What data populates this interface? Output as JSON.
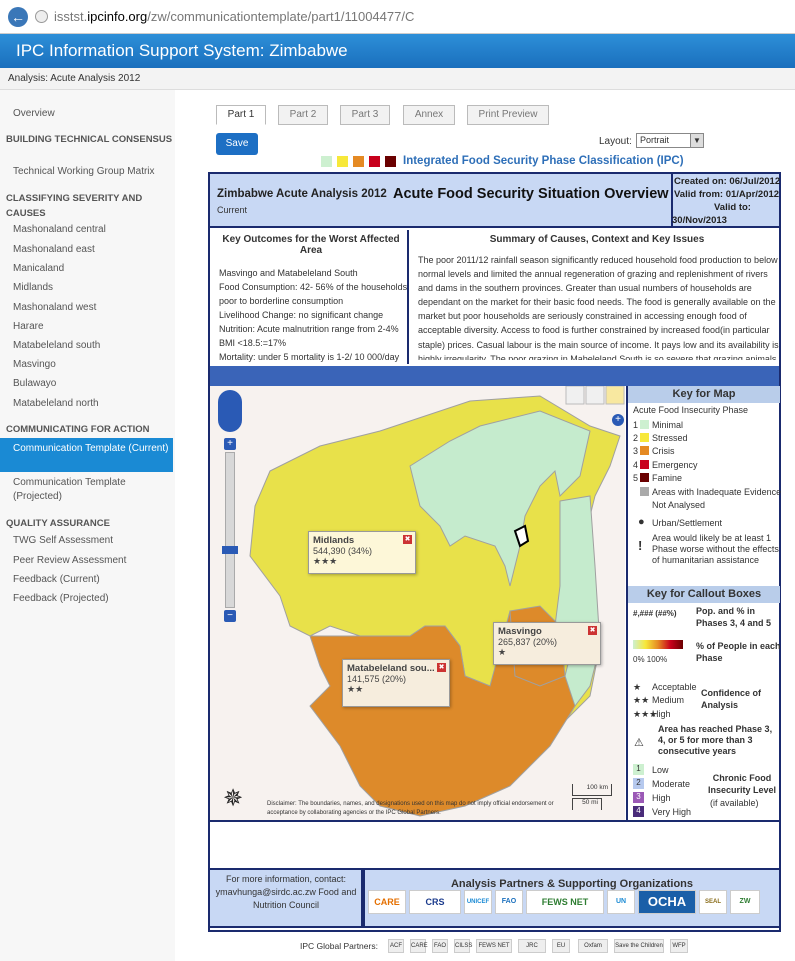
{
  "browser": {
    "url_prefix": "isstst.",
    "url_domain": "ipcinfo.org",
    "url_path": "/zw/communicationtemplate/part1/11004477/C"
  },
  "banner": {
    "title": "IPC Information Support System: Zimbabwe"
  },
  "analysis_bar": {
    "label": "Analysis: Acute Analysis 2012"
  },
  "sidebar": {
    "overview": "Overview",
    "section1": "BUILDING TECHNICAL CONSENSUS",
    "twg_matrix": "Technical Working Group Matrix",
    "section2": "CLASSIFYING SEVERITY AND CAUSES",
    "regions": [
      "Mashonaland central",
      "Mashonaland east",
      "Manicaland",
      "Midlands",
      "Mashonaland west",
      "Harare",
      "Matabeleland south",
      "Masvingo",
      "Bulawayo",
      "Matabeleland north"
    ],
    "section3": "COMMUNICATING FOR ACTION",
    "comm_current": "Communication Template (Current)",
    "comm_projected": "Communication Template (Projected)",
    "section4": "QUALITY ASSURANCE",
    "qa": [
      "TWG Self Assessment",
      "Peer Review Assessment",
      "Feedback (Current)",
      "Feedback (Projected)"
    ]
  },
  "tabs": [
    "Part 1",
    "Part 2",
    "Part 3",
    "Annex",
    "Print Preview"
  ],
  "toolbar": {
    "save": "Save",
    "layout_label": "Layout:",
    "layout_value": "Portrait"
  },
  "ipc_link": "Integrated Food Security Phase Classification (IPC)",
  "phase_colors": [
    "#cdf0d0",
    "#f7e83a",
    "#e58a23",
    "#c8001c",
    "#6a0000"
  ],
  "header": {
    "title": "Zimbabwe Acute Analysis 2012",
    "subtitle": "Current",
    "main_title": "Acute Food Security Situation Overview",
    "created": "Created on: 06/Jul/2012",
    "valid_from": "Valid from: 01/Apr/2012",
    "valid_to": "Valid to:",
    "valid_to_date": "30/Nov/2013"
  },
  "key_outcomes": {
    "heading": "Key Outcomes for the Worst Affected Area",
    "lines": [
      "Masvingo and Matabeleland South",
      "Food Consumption: 42- 56% of the households poor to borderline consumption",
      "Livelihood Change: no significant change",
      "Nutrition: Acute malnutrition range from 2-4% BMI <18.5:=17%",
      "Mortality: under 5 mortality is 1-2/ 10 000/day"
    ]
  },
  "summary": {
    "heading": "Summary of Causes, Context and Key Issues",
    "text": "The poor 2011/12 rainfall season significantly reduced household food production to below normal levels and limited the annual regeneration of grazing and replenishment of rivers and dams in the southern provinces. Greater than usual numbers of households are dependant on the market for their basic food needs. The food is generally available on the market but poor households are seriously constrained in accessing enough food of acceptable diversity. Access to food is further constrained by increased food(in particular staple) prices. Casual labour is the main source of income. It pays low and its availability is highly irregularity. The poor grazing in Mabeleland South is so severe that grazing animals has"
  },
  "callouts": {
    "midlands": {
      "name": "Midlands",
      "value": "544,390 (34%)",
      "stars": "★★★"
    },
    "masvingo": {
      "name": "Masvingo",
      "value": "265,837 (20%)",
      "stars": "★"
    },
    "matabeleland": {
      "name": "Matabeleland sou...",
      "value": "141,575 (20%)",
      "stars": "★★"
    }
  },
  "map": {
    "disclaimer": "Disclaimer: The boundaries, names, and designations used on this map do not imply official endorsement or acceptance by collaborating agencies or the IPC Global Partners.",
    "scale_km": "100 km",
    "scale_mi": "50 mi",
    "compass": "N E S W"
  },
  "key_map": {
    "heading": "Key for Map",
    "phase_title": "Acute Food Insecurity Phase",
    "phases": [
      {
        "num": "1",
        "label": "Minimal"
      },
      {
        "num": "2",
        "label": "Stressed"
      },
      {
        "num": "3",
        "label": "Crisis"
      },
      {
        "num": "4",
        "label": "Emergency"
      },
      {
        "num": "5",
        "label": "Famine"
      }
    ],
    "inadequate": "Areas with Inadequate Evidence",
    "not_analysed": "Not Analysed",
    "urban": "Urban/Settlement",
    "worse": "Area would likely be at least 1 Phase worse without the effects of humanitarian assistance"
  },
  "key_callout": {
    "heading": "Key for Callout Boxes",
    "pop_sym": "#,### (##%)",
    "pop_desc": "Pop. and % in Phases 3, 4 and 5",
    "pct_range": "0%  100%",
    "pct_desc": "% of People in each Phase",
    "conf": [
      "Acceptable",
      "Medium",
      "High"
    ],
    "conf_title": "Confidence of Analysis",
    "chronic_note": "Area has reached Phase 3, 4, or 5 for more than 3 consecutive years",
    "chronic_levels": [
      {
        "num": "1",
        "label": "Low"
      },
      {
        "num": "2",
        "label": "Moderate"
      },
      {
        "num": "3",
        "label": "High"
      },
      {
        "num": "4",
        "label": "Very High"
      }
    ],
    "chronic_title": "Chronic Food Insecurity Level",
    "chronic_sub": "(if available)"
  },
  "footer": {
    "contact": "For more information, contact: ymavhunga@sirdc.ac.zw Food and Nutrition Council",
    "partners_heading": "Analysis Partners & Supporting Organizations",
    "logos": [
      "CARE",
      "CRS",
      "UNICEF",
      "FAO",
      "FEWS NET",
      "UN",
      "OCHA",
      "SEAL",
      "ZW"
    ],
    "global_partners": "IPC Global Partners:",
    "global_logos": [
      "ACF",
      "CARE",
      "FAO",
      "CILSS",
      "FEWS NET",
      "JRC",
      "EU",
      "Oxfam",
      "Save the Children",
      "WFP"
    ]
  }
}
